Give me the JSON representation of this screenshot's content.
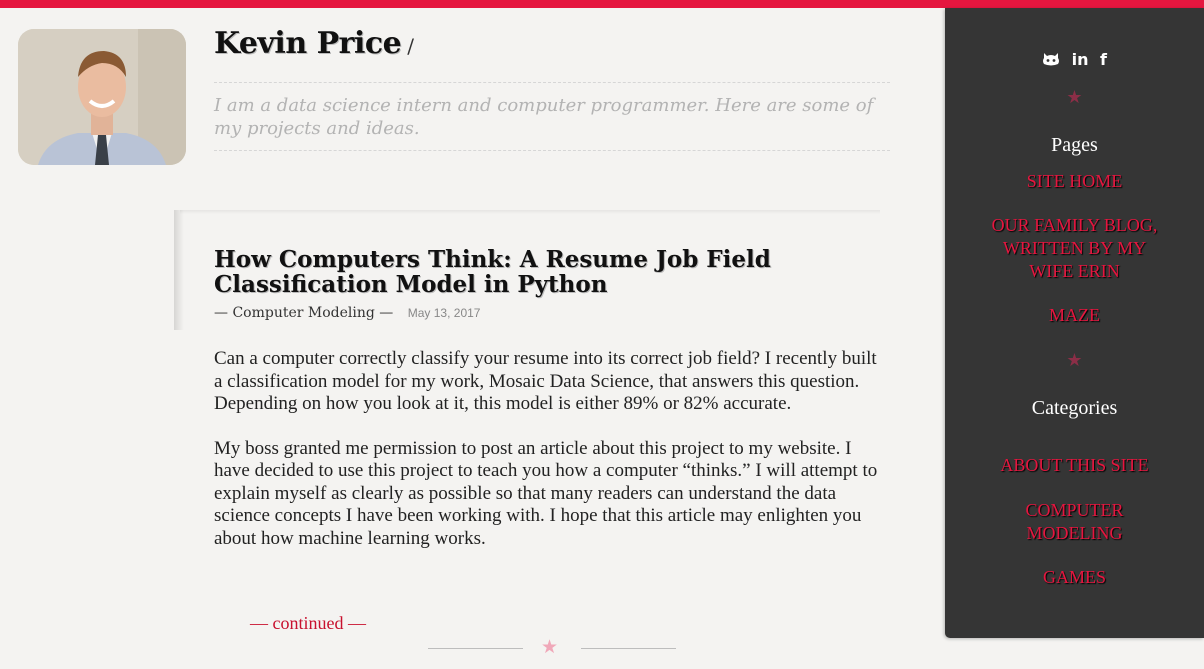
{
  "header": {
    "name": "Kevin Price",
    "slash": "/",
    "tagline": "I am a data science intern and computer programmer. Here are some of my projects and ideas."
  },
  "post": {
    "title": "How Computers Think: A Resume Job Field Classification Model in Python",
    "category": "— Computer Modeling —",
    "date": "May 13, 2017",
    "paragraphs": [
      "Can a computer correctly classify your resume into its correct job field? I recently built a classification model for my work, Mosaic Data Science, that answers this question. Depending on how you look at it, this model is either 89% or 82% accurate.",
      "My boss granted me permission to post an article about this project to my website. I have decided to use this project to teach you how a computer “thinks.” I will attempt to explain myself as clearly as possible so that many readers can understand the data science concepts I have been working with. I hope that this article may enlighten you about how machine learning works."
    ],
    "continued": "— continued —"
  },
  "sidebar": {
    "social": {
      "github": "github-icon",
      "linkedin": "in",
      "facebook": "f"
    },
    "pages_heading": "Pages",
    "pages": [
      "SITE HOME",
      "OUR FAMILY BLOG, WRITTEN BY MY WIFE ERIN",
      "MAZE"
    ],
    "categories_heading": "Categories",
    "categories": [
      "ABOUT THIS SITE",
      "COMPUTER MODELING",
      "GAMES"
    ]
  },
  "colors": {
    "accent": "#e5163f",
    "sidebar": "#353535",
    "star": "#8c2e47"
  }
}
